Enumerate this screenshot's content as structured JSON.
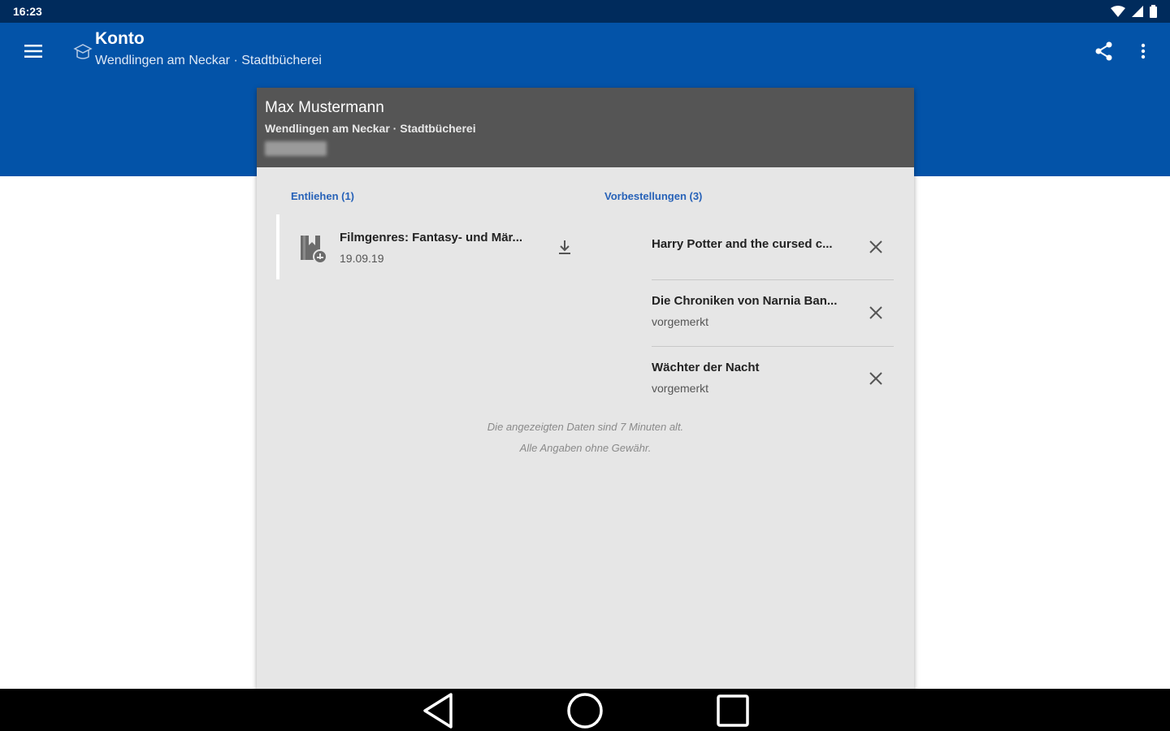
{
  "status_bar": {
    "time": "16:23",
    "icons": [
      "wifi-icon",
      "signal-icon",
      "battery-icon"
    ]
  },
  "app_bar": {
    "title": "Konto",
    "subtitle": "Wendlingen am Neckar · Stadtbücherei",
    "menu_icon": "hamburger-menu-icon",
    "library_icon": "library-logo-icon",
    "share_icon": "share-icon",
    "overflow_icon": "more-vert-icon",
    "color": "#0353a8"
  },
  "account": {
    "name": "Max Mustermann",
    "library": "Wendlingen am Neckar · Stadtbücherei",
    "card_number_redacted": true
  },
  "lent": {
    "title": "Entliehen (1)",
    "items": [
      {
        "title": "Filmgenres: Fantasy- und Mär...",
        "date": "19.09.19",
        "icon": "ebook-download-icon",
        "action_icon": "download-icon"
      }
    ]
  },
  "reservations": {
    "title": "Vorbestellungen (3)",
    "items": [
      {
        "title": "Harry Potter and the cursed c...",
        "status": ""
      },
      {
        "title": "Die Chroniken von Narnia Ban...",
        "status": "vorgemerkt"
      },
      {
        "title": "Wächter der Nacht",
        "status": "vorgemerkt"
      }
    ],
    "action_icon": "close-icon"
  },
  "footer": {
    "line1": "Die angezeigten Daten sind 7 Minuten alt.",
    "line2": "Alle Angaben ohne Gewähr."
  },
  "accent_color": "#2762b8",
  "nav_bar": {
    "icons": [
      "back-icon",
      "home-icon",
      "recents-icon"
    ]
  }
}
